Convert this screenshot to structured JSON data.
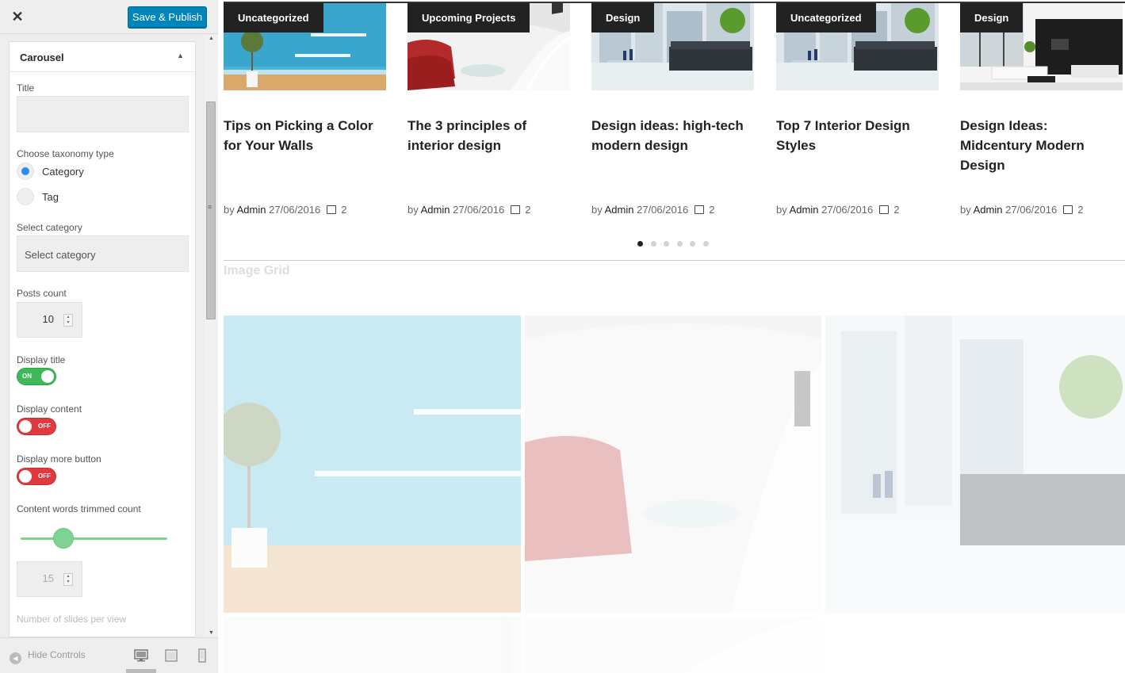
{
  "sidebar": {
    "close_glyph": "✕",
    "publish_label": "Save & Publish",
    "panel": {
      "title": "Carousel",
      "caret": "▲",
      "title_field_label": "Title",
      "title_value": "",
      "taxonomy_label": "Choose taxonomy type",
      "taxonomy_options": [
        {
          "label": "Category",
          "checked": true
        },
        {
          "label": "Tag",
          "checked": false
        }
      ],
      "category_label": "Select category",
      "category_value": "Select category",
      "posts_count_label": "Posts count",
      "posts_count_value": "10",
      "display_title_label": "Display title",
      "display_title_state": "ON",
      "display_content_label": "Display content",
      "display_content_state": "OFF",
      "display_more_label": "Display more button",
      "display_more_state": "OFF",
      "trim_label": "Content words trimmed count",
      "trim_slider_fraction": 0.29,
      "trim_value": "15",
      "slides_label": "Number of slides per view"
    },
    "footer": {
      "hide_controls": "Hide Controls",
      "icons": [
        "desktop-icon",
        "tablet-icon",
        "mobile-icon"
      ]
    }
  },
  "preview": {
    "cards": [
      {
        "tag": "Uncategorized",
        "title": "Tips on Picking a Color for Your Walls",
        "by": "by",
        "author": "Admin",
        "date": "27/06/2016",
        "comments": "2",
        "image": "blue-room"
      },
      {
        "tag": "Upcoming Projects",
        "title": "The 3 principles of interior design",
        "by": "by",
        "author": "Admin",
        "date": "27/06/2016",
        "comments": "2",
        "image": "white-red-room"
      },
      {
        "tag": "Design",
        "title": "Design ideas: high-tech modern design",
        "by": "by",
        "author": "Admin",
        "date": "27/06/2016",
        "comments": "2",
        "image": "city-sofa-room"
      },
      {
        "tag": "Uncategorized",
        "title": "Top 7 Interior Design Styles",
        "by": "by",
        "author": "Admin",
        "date": "27/06/2016",
        "comments": "2",
        "image": "city-sofa-room"
      },
      {
        "tag": "Design",
        "title": "Design Ideas: Midcentury Modern Design",
        "by": "by",
        "author": "Admin",
        "date": "27/06/2016",
        "comments": "2",
        "image": "living-room"
      }
    ],
    "pagination_dots": 6,
    "active_dot": 0,
    "section_title": "Image Grid"
  },
  "colors": {
    "publish": "#0085ba",
    "toggle_on": "#3db85a",
    "toggle_off": "#e0393e",
    "radio_checked": "#2e8ce6",
    "slider": "#7fd392"
  }
}
